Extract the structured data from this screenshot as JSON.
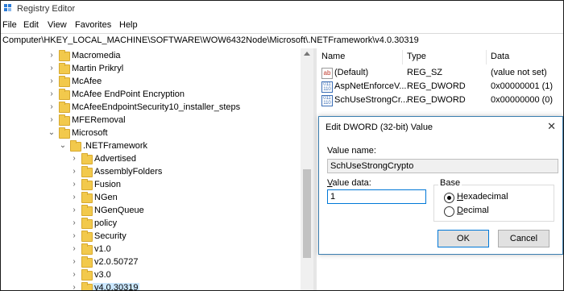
{
  "window": {
    "title": "Registry Editor"
  },
  "menu": [
    "File",
    "Edit",
    "View",
    "Favorites",
    "Help"
  ],
  "address": "Computer\\HKEY_LOCAL_MACHINE\\SOFTWARE\\WOW6432Node\\Microsoft\\.NETFramework\\v4.0.30319",
  "tree": {
    "items": [
      {
        "label": "Macromedia",
        "expanded": false
      },
      {
        "label": "Martin Prikryl",
        "expanded": false
      },
      {
        "label": "McAfee",
        "expanded": false
      },
      {
        "label": "McAfee EndPoint Encryption",
        "expanded": false
      },
      {
        "label": "McAfeeEndpointSecurity10_installer_steps",
        "expanded": false
      },
      {
        "label": "MFERemoval",
        "expanded": false
      },
      {
        "label": "Microsoft",
        "expanded": true
      },
      {
        "label": ".NETFramework",
        "expanded": true
      },
      {
        "label": "Advertised",
        "expanded": false
      },
      {
        "label": "AssemblyFolders",
        "expanded": false
      },
      {
        "label": "Fusion",
        "expanded": false
      },
      {
        "label": "NGen",
        "expanded": false
      },
      {
        "label": "NGenQueue",
        "expanded": false
      },
      {
        "label": "policy",
        "expanded": false
      },
      {
        "label": "Security",
        "expanded": false
      },
      {
        "label": "v1.0",
        "expanded": false
      },
      {
        "label": "v2.0.50727",
        "expanded": false
      },
      {
        "label": "v3.0",
        "expanded": false
      },
      {
        "label": "v4.0.30319",
        "expanded": false,
        "selected": true
      }
    ]
  },
  "list": {
    "headers": {
      "name": "Name",
      "type": "Type",
      "data": "Data"
    },
    "rows": [
      {
        "icon": "string-value-icon",
        "name": "(Default)",
        "type": "REG_SZ",
        "data": "(value not set)"
      },
      {
        "icon": "binary-value-icon",
        "name": "AspNetEnforceV...",
        "type": "REG_DWORD",
        "data": "0x00000001 (1)"
      },
      {
        "icon": "binary-value-icon",
        "name": "SchUseStrongCr...",
        "type": "REG_DWORD",
        "data": "0x00000000 (0)"
      }
    ]
  },
  "dialog": {
    "title": "Edit DWORD (32-bit) Value",
    "close": "✕",
    "value_name_label": "Value name:",
    "value_name_label_prefix": "Value ",
    "value_name_label_accel": "n",
    "value_name_label_suffix": "ame:",
    "value_name": "SchUseStrongCrypto",
    "value_data_label_prefix": "",
    "value_data_label_accel": "V",
    "value_data_label_suffix": "alue data:",
    "value_data": "1",
    "base_label": "Base",
    "hex_accel": "H",
    "hex_rest": "exadecimal",
    "dec_accel": "D",
    "dec_rest": "ecimal",
    "base_selected": "Hexadecimal",
    "ok_label": "OK",
    "cancel_label": "Cancel"
  },
  "colors": {
    "selection": "#cce8ff",
    "folder": "#f2c94c",
    "accent": "#0078d7"
  }
}
